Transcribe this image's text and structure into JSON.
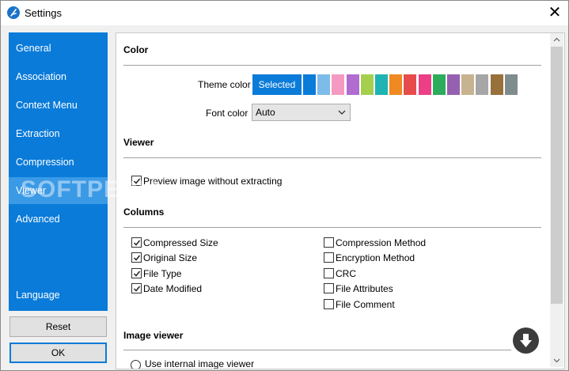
{
  "window": {
    "title": "Settings",
    "app_icon": "feather-icon",
    "close_glyph": "✕"
  },
  "sidebar": {
    "items": [
      {
        "label": "General"
      },
      {
        "label": "Association"
      },
      {
        "label": "Context Menu"
      },
      {
        "label": "Extraction"
      },
      {
        "label": "Compression"
      },
      {
        "label": "Viewer",
        "active": true
      },
      {
        "label": "Advanced"
      },
      {
        "label": "Language"
      }
    ],
    "accent": "#0a7bd9",
    "active_color": "#3b9ae6"
  },
  "buttons": {
    "reset": "Reset",
    "ok": "OK"
  },
  "color_section": {
    "title": "Color",
    "theme_label": "Theme color",
    "selected_label": "Selected",
    "swatches": [
      "#0a7bd9",
      "#7dbbe8",
      "#f49ac2",
      "#b06ccf",
      "#a6cf4e",
      "#1fb3b3",
      "#ef8a22",
      "#e74c4c",
      "#ec3f86",
      "#2dac5b",
      "#9660b0",
      "#c7b38f",
      "#a6a6a6",
      "#98703a",
      "#7f8c8d"
    ],
    "font_label": "Font color",
    "font_value": "Auto"
  },
  "viewer_section": {
    "title": "Viewer",
    "preview_label": "Preview image without extracting",
    "preview_checked": true
  },
  "columns_section": {
    "title": "Columns",
    "left": [
      {
        "label": "Compressed Size",
        "checked": true
      },
      {
        "label": "Original Size",
        "checked": true
      },
      {
        "label": "File Type",
        "checked": true
      },
      {
        "label": "Date Modified",
        "checked": true
      }
    ],
    "right": [
      {
        "label": "Compression Method",
        "checked": false
      },
      {
        "label": "Encryption Method",
        "checked": false
      },
      {
        "label": "CRC",
        "checked": false
      },
      {
        "label": "File Attributes",
        "checked": false
      },
      {
        "label": "File Comment",
        "checked": false
      }
    ]
  },
  "image_viewer_section": {
    "title": "Image viewer",
    "radio_label": "Use internal image viewer"
  },
  "watermark": "SOFTPEDIA"
}
